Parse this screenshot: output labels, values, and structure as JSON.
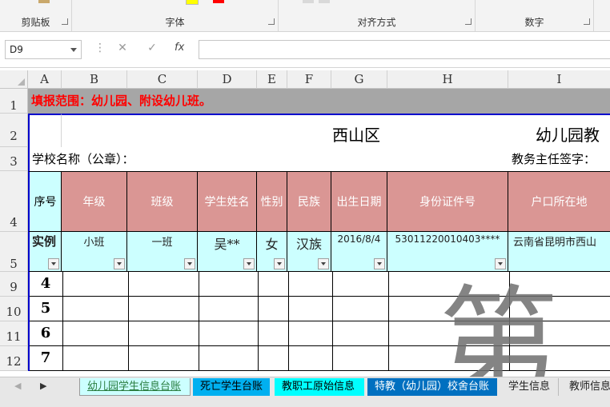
{
  "ribbon": {
    "groups": [
      {
        "label": "剪贴板"
      },
      {
        "label": "字体"
      },
      {
        "label": "对齐方式"
      },
      {
        "label": "数字"
      }
    ]
  },
  "formula_bar": {
    "name_box": "D9",
    "cancel_glyph": "✕",
    "enter_glyph": "✓",
    "fx": "fx",
    "value": ""
  },
  "sheet": {
    "columns": [
      "A",
      "B",
      "C",
      "D",
      "E",
      "F",
      "G",
      "H",
      "I"
    ],
    "rows": [
      "1",
      "2",
      "3",
      "4",
      "5",
      "9",
      "10",
      "11",
      "12"
    ],
    "banner": "填报范围：幼儿园、附设幼儿班。",
    "title_left": "西山区",
    "title_right": "幼儿园教",
    "school_name_label": "学校名称（公章）：",
    "director_label": "教务主任签字：",
    "headers": [
      "序号",
      "年级",
      "班级",
      "学生姓名",
      "性别",
      "民族",
      "出生日期",
      "身份证件号",
      "户口所在地"
    ],
    "example": [
      "实例",
      "小班",
      "一班",
      "吴**",
      "女",
      "汉族",
      "2016/8/4",
      "53011220010403****",
      "云南省昆明市西山"
    ],
    "seq_numbers": [
      "4",
      "5",
      "6",
      "7"
    ],
    "watermark": "第",
    "colors": {
      "banner_bg": "#a6a6a6",
      "banner_text": "#ff0000",
      "header_bg": "#da9694",
      "example_bg": "#ccffff",
      "title_border": "#0000cc"
    }
  },
  "tabs": [
    {
      "label": "幼儿园学生信息台账",
      "active": true,
      "color": "#ccffff"
    },
    {
      "label": "死亡学生台账",
      "active": false,
      "color": "#00b0f0"
    },
    {
      "label": "教职工原始信息",
      "active": false,
      "color": "#00ffff"
    },
    {
      "label": "特教（幼儿园）校舍台账",
      "active": false,
      "color": "#0070c0"
    },
    {
      "label": "学生信息",
      "active": false,
      "color": ""
    },
    {
      "label": "教师信息",
      "active": false,
      "color": ""
    }
  ]
}
